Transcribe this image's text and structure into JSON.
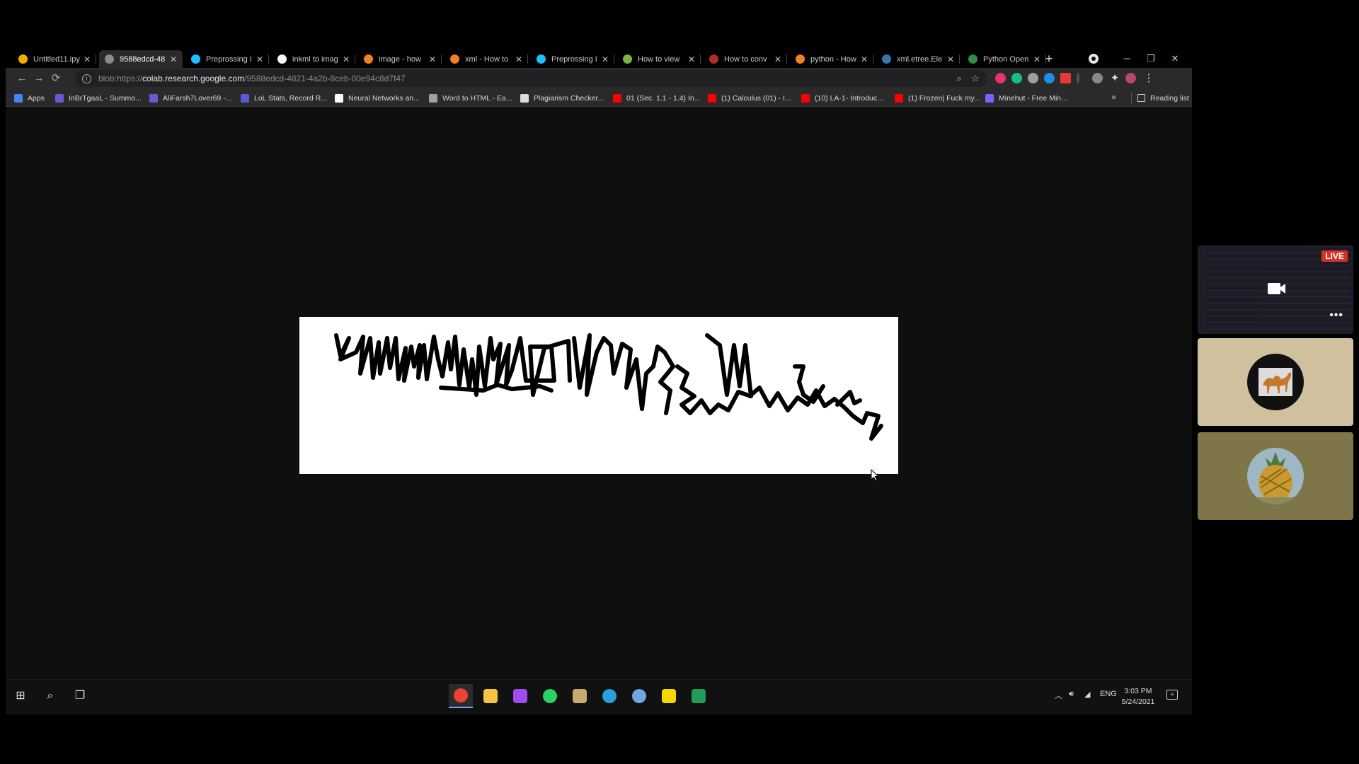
{
  "browser": {
    "tabs": [
      {
        "title": "Untitled11.ipy",
        "icon": "colab-icon",
        "color": "#f9ab00"
      },
      {
        "title": "9588edcd-48",
        "icon": "globe-icon",
        "color": "#8a8a8a",
        "active": true
      },
      {
        "title": "Preprossing I",
        "icon": "kaggle-icon",
        "color": "#20beff"
      },
      {
        "title": "inkml to imag",
        "icon": "google-icon",
        "color": "#ffffff"
      },
      {
        "title": "image - how",
        "icon": "stackoverflow-icon",
        "color": "#f48024"
      },
      {
        "title": "xml - How to",
        "icon": "stackoverflow-icon",
        "color": "#f48024"
      },
      {
        "title": "Preprossing I",
        "icon": "kaggle-icon",
        "color": "#20beff"
      },
      {
        "title": "How to view",
        "icon": "heart-icon",
        "color": "#7cb342"
      },
      {
        "title": "How to conv",
        "icon": "quora-icon",
        "color": "#b92b27"
      },
      {
        "title": "python - How",
        "icon": "stackoverflow-icon",
        "color": "#f48024"
      },
      {
        "title": "xml.etree.Ele",
        "icon": "python-icon",
        "color": "#3776ab"
      },
      {
        "title": "Python Open",
        "icon": "geeks-icon",
        "color": "#2f8d46"
      }
    ],
    "new_tab": "+",
    "window_controls": {
      "minimize": "─",
      "restore": "❐",
      "close": "✕"
    },
    "address": {
      "scheme": "blob:https://",
      "host": "colab.research.google.com",
      "path": "/9588edcd-4821-4a2b-8ceb-00e94c8d7f47"
    },
    "bookmarks": [
      {
        "label": "Apps",
        "color": "#4285f4"
      },
      {
        "label": "InBrTgaaL - Summo...",
        "color": "#6a5acd"
      },
      {
        "label": "AliFarsh7Lover69 -...",
        "color": "#6a5acd"
      },
      {
        "label": "LoL Stats, Record R...",
        "color": "#5b5bd6"
      },
      {
        "label": "Neural Networks an...",
        "color": "#ffffff"
      },
      {
        "label": "Word to HTML - Ea...",
        "color": "#9aa0a6"
      },
      {
        "label": "Plagiarism Checker...",
        "color": "#dddddd"
      },
      {
        "label": "01 (Sec. 1.1 - 1.4) In...",
        "color": "#ff0000"
      },
      {
        "label": "(1) Calculus (01) - I...",
        "color": "#ff0000"
      },
      {
        "label": "(10) LA-1- Introduc...",
        "color": "#ff0000"
      },
      {
        "label": "(1) Frozen| Fuck my...",
        "color": "#ff0000"
      },
      {
        "label": "Minehut - Free Min...",
        "color": "#7b61ff"
      }
    ],
    "bookmarks_more": "»",
    "reading_list": "Reading list"
  },
  "taskbar": {
    "time": "3:03 PM",
    "date": "5/24/2021",
    "language": "ENG",
    "apps": [
      {
        "name": "chrome",
        "color": "#ea4335",
        "active": true
      },
      {
        "name": "file-explorer",
        "color": "#f6c343"
      },
      {
        "name": "messenger",
        "color": "#a04cf0"
      },
      {
        "name": "whatsapp",
        "color": "#25d366"
      },
      {
        "name": "league",
        "color": "#c8aa6e"
      },
      {
        "name": "telegram",
        "color": "#2aa1da"
      },
      {
        "name": "app-blue",
        "color": "#6fa8dc"
      },
      {
        "name": "sticky-notes",
        "color": "#f7d600"
      },
      {
        "name": "spreadsheet",
        "color": "#1e9e5a"
      }
    ]
  },
  "meeting": {
    "live_label": "LIVE",
    "more": "•••"
  }
}
